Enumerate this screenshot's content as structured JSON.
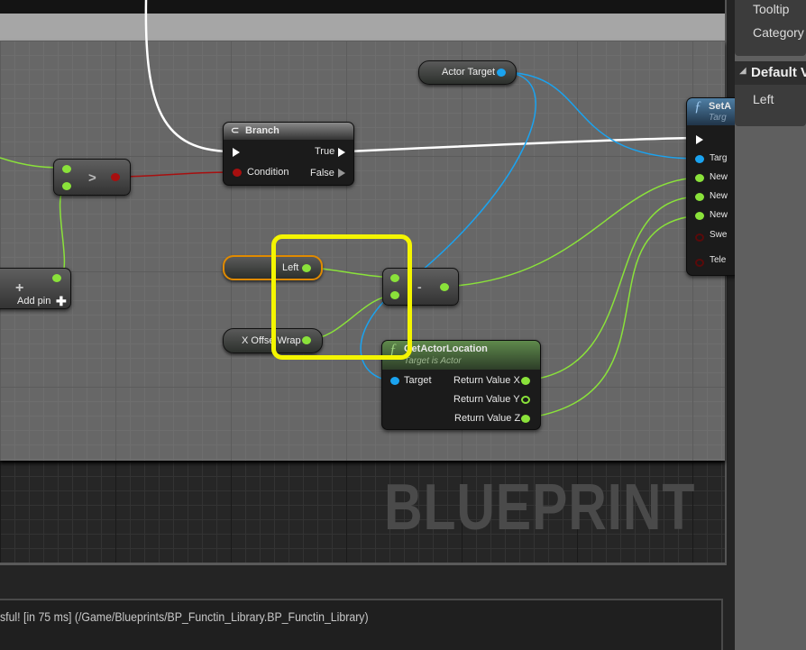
{
  "graph": {
    "watermark": "BLUEPRINT",
    "nodes": {
      "actor_target": {
        "label": "Actor Target"
      },
      "branch": {
        "title": "Branch",
        "condition": "Condition",
        "true_label": "True",
        "false_label": "False"
      },
      "greater": {
        "symbol": ">"
      },
      "make": {
        "add_pin": "Add pin",
        "plus": "+"
      },
      "left_var": {
        "label": "Left"
      },
      "x_offset": {
        "label": "X Offse Wrap"
      },
      "subtract": {
        "symbol": "-"
      },
      "get_actor_location": {
        "title": "GetActorLocation",
        "subtitle": "Target is Actor",
        "target": "Target",
        "rx": "Return Value X",
        "ry": "Return Value Y",
        "rz": "Return Value Z"
      },
      "set_node": {
        "title": "SetA",
        "subtitle": "Targ",
        "pins": [
          "Targ",
          "New",
          "New",
          "New",
          "Swe",
          "Tele"
        ]
      }
    },
    "colors": {
      "float": "#8ae23a",
      "object": "#1aa3f0",
      "bool": "#a80f0f",
      "highlight": "#f4f500"
    }
  },
  "details": {
    "tooltip": "Tooltip",
    "category": "Category",
    "section": "Default V",
    "left": "Left"
  },
  "log": {
    "message": "sful! [in 75 ms] (/Game/Blueprints/BP_Functin_Library.BP_Functin_Library)"
  }
}
